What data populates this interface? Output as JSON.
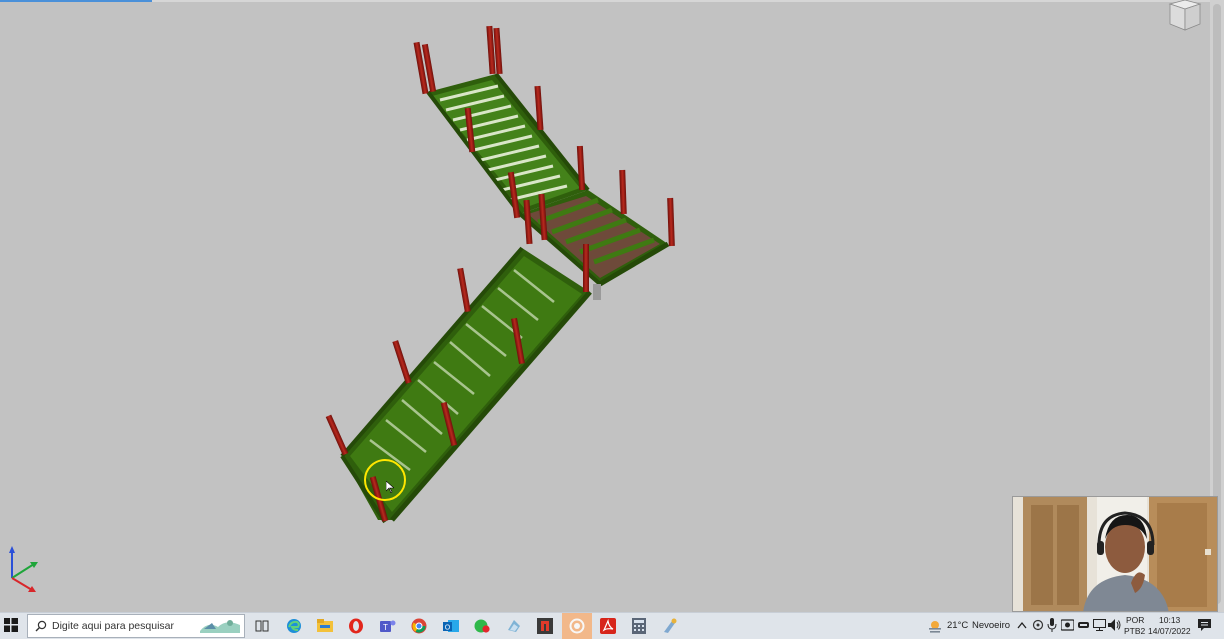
{
  "taskbar": {
    "search_placeholder": "Digite aqui para pesquisar",
    "apps": [
      {
        "name": "task-view-icon",
        "active": false
      },
      {
        "name": "edge-icon",
        "active": false
      },
      {
        "name": "file-explorer-icon",
        "active": false
      },
      {
        "name": "opera-icon",
        "active": false
      },
      {
        "name": "teams-icon",
        "active": false
      },
      {
        "name": "chrome-icon",
        "active": false
      },
      {
        "name": "outlook-icon",
        "active": false
      },
      {
        "name": "whatsapp-icon",
        "active": false
      },
      {
        "name": "generic-app-icon",
        "active": false
      },
      {
        "name": "tekla-icon",
        "active": false
      },
      {
        "name": "recording-app-icon",
        "active": true
      },
      {
        "name": "acrobat-icon",
        "active": false
      },
      {
        "name": "calculator-icon",
        "active": false
      },
      {
        "name": "paint-icon",
        "active": false
      }
    ],
    "weather": {
      "temp": "21°C",
      "condition": "Nevoeiro"
    },
    "language": {
      "line1": "POR",
      "line2": "PTB2"
    },
    "clock": {
      "time": "10:13",
      "date": "14/07/2022"
    }
  },
  "colors": {
    "viewport_bg": "#c2c2c2",
    "steel_green": "#3f7a12",
    "post_red": "#9b1a12",
    "landing_brown": "#6e4a3a",
    "taskbar_bg": "#dfe4ea"
  }
}
